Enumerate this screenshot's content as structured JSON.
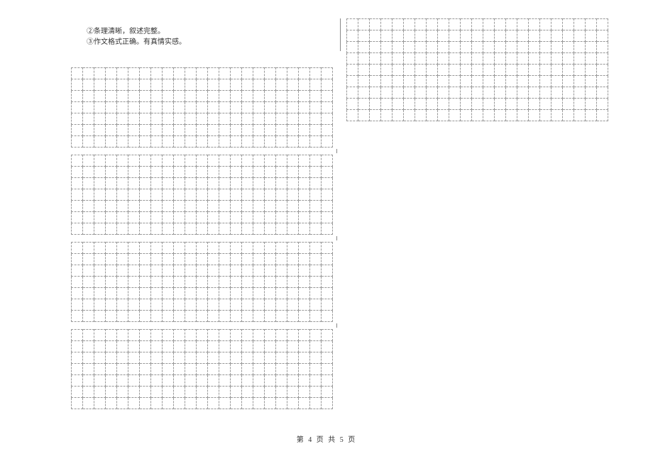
{
  "instructions": {
    "line1": "②条理清晰，叙述完整。",
    "line2": "③作文格式正确。有真情实感。"
  },
  "grid": {
    "left_cols": 23,
    "right_cols": 23,
    "block_rows": 7,
    "right_rows": 9
  },
  "footer": {
    "page_label": "第 4 页 共 5 页"
  }
}
